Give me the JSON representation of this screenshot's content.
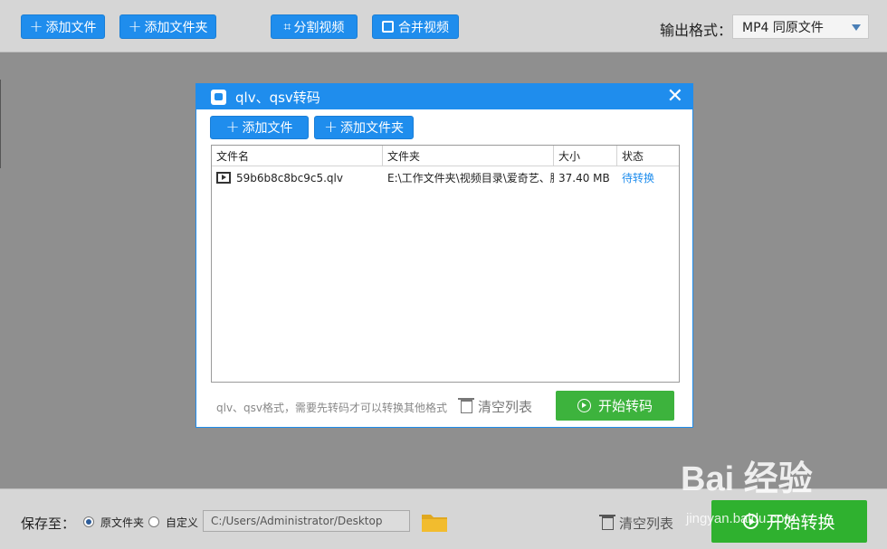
{
  "toolbar": {
    "add_file": "添加文件",
    "add_folder": "添加文件夹",
    "split_video": "分割视频",
    "merge_video": "合并视频",
    "output_format_label": "输出格式：",
    "output_format_value": "MP4  同原文件"
  },
  "dialog": {
    "title": "qlv、qsv转码",
    "add_file": "添加文件",
    "add_folder": "添加文件夹",
    "columns": [
      "文件名",
      "文件夹",
      "大小",
      "状态"
    ],
    "rows": [
      {
        "name": "59b6b8c8bc9c5.qlv",
        "folder": "E:\\工作文件夹\\视频目录\\爱奇艺、腾",
        "size": "37.40 MB",
        "status": "待转换"
      }
    ],
    "hint": "qlv、qsv格式，需要先转码才可以转换其他格式",
    "clear_list": "清空列表",
    "start": "开始转码"
  },
  "bottom": {
    "save_to_label": "保存至：",
    "option_original": "原文件夹",
    "option_custom": "自定义",
    "path_value": "C:/Users/Administrator/Desktop",
    "clear_list": "清空列表",
    "start": "开始转换"
  },
  "watermark": {
    "brand": "Bai 经验",
    "url": "jingyan.baidu.com"
  },
  "colors": {
    "accent": "#1f8ded",
    "start_green": "#2fb12f",
    "status_link": "#1f8ded"
  }
}
